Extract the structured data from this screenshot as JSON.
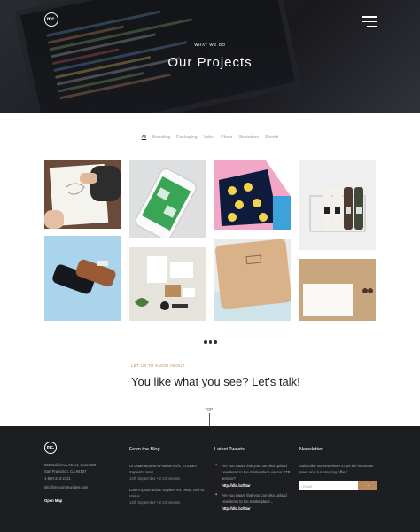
{
  "header": {
    "logo_text": "mc.",
    "menu_icon": "hamburger-icon",
    "eyebrow": "WHAT WE DO",
    "title": "Our Projects"
  },
  "filters": {
    "items": [
      {
        "label": "All",
        "active": true
      },
      {
        "label": "Branding",
        "active": false
      },
      {
        "label": "Packaging",
        "active": false
      },
      {
        "label": "Video",
        "active": false
      },
      {
        "label": "Photo",
        "active": false
      },
      {
        "label": "Illustration",
        "active": false
      },
      {
        "label": "Sketch",
        "active": false
      }
    ]
  },
  "projects": [
    {
      "name": "notebook-sketch"
    },
    {
      "name": "phone-mockup"
    },
    {
      "name": "pink-yellow-art"
    },
    {
      "name": "bottles-carrier"
    },
    {
      "name": "phone-case-on-blue"
    },
    {
      "name": "stationery-set"
    },
    {
      "name": "kraft-notebook"
    },
    {
      "name": "envelope-card"
    }
  ],
  "pagination": {
    "icon": "more-dots-icon"
  },
  "cta": {
    "eyebrow": "LET US TO KNOW ABOUT",
    "text": "You like what you see? Let’s talk!",
    "arrow": "→",
    "accent": "#b8895a"
  },
  "scroll_top": {
    "label": "TOP"
  },
  "footer": {
    "logo_text": "mc.",
    "address_lines": [
      "555 California Street, Suite 200",
      "San Francisco, CA 94107",
      "1-800-313-2121"
    ],
    "email": "info@mecommunities.com",
    "open_map": "Open Map",
    "blog": {
      "heading": "From the Blog",
      "posts": [
        {
          "title": "Ut Quae Museum Praesent Vix, Et Etiam Sapient Lorem",
          "meta": "14th September • 2 Comments"
        },
        {
          "title": "Lorem Ipsum Etiam Sapient Vix Deus, Sed Et Varius",
          "meta": "12th September • 2 Comments"
        }
      ]
    },
    "tweets": {
      "heading": "Latest Tweets",
      "items": [
        {
          "text": "Are you aware that you can also upload new items to the marketplace via our FTP service?",
          "link": "http://dld.bz/f4ar"
        },
        {
          "text": "Are you aware that you can also upload new items to the marketplace...",
          "link": "http://dld.bz/f4ar"
        }
      ]
    },
    "newsletter": {
      "heading": "Newsletter",
      "text": "Subscribe our newsletter to get the important news and our amazing offers:",
      "placeholder": "Email",
      "button_icon": "arrow-right-icon"
    }
  },
  "colors": {
    "accent": "#b8895a",
    "footer_bg": "#1d1e22"
  }
}
